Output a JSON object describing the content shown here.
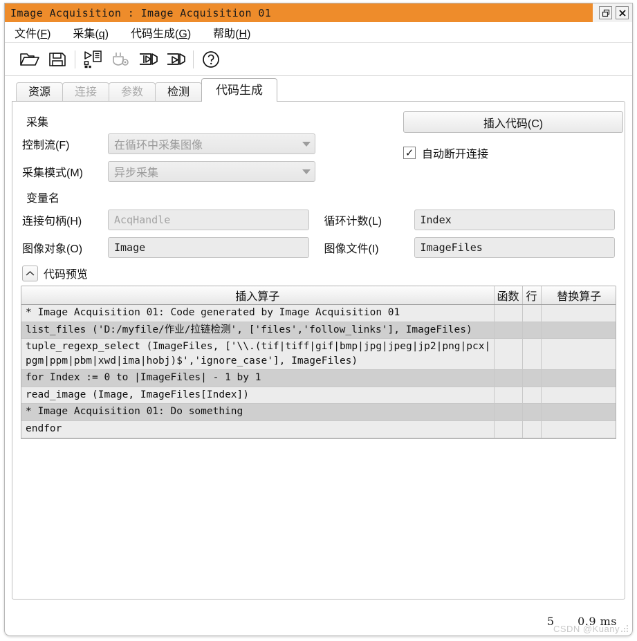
{
  "window": {
    "title": "Image Acquisition : Image Acquisition 01",
    "restore_icon": "restore-window-icon",
    "close_icon": "close-window-icon"
  },
  "menubar": {
    "items": [
      {
        "label": "文件",
        "accel": "F"
      },
      {
        "label": "采集",
        "accel": "q"
      },
      {
        "label": "代码生成",
        "accel": "G"
      },
      {
        "label": "帮助",
        "accel": "H"
      }
    ]
  },
  "toolbar": {
    "items": [
      {
        "icon": "open-folder-icon",
        "enabled": true
      },
      {
        "icon": "save-icon",
        "enabled": true
      },
      {
        "icon": "generate-code-icon",
        "enabled": true
      },
      {
        "icon": "connect-settings-icon",
        "enabled": false
      },
      {
        "icon": "live-grab-start-icon",
        "enabled": true
      },
      {
        "icon": "snap-grab-icon",
        "enabled": true
      },
      {
        "icon": "help-icon",
        "enabled": true
      }
    ]
  },
  "tabs": [
    {
      "label": "资源",
      "state": "normal"
    },
    {
      "label": "连接",
      "state": "disabled"
    },
    {
      "label": "参数",
      "state": "disabled"
    },
    {
      "label": "检测",
      "state": "normal"
    },
    {
      "label": "代码生成",
      "state": "selected"
    }
  ],
  "form": {
    "acquire_group_title": "采集",
    "control_flow_label": "控制流(F)",
    "control_flow_value": "在循环中采集图像",
    "acquire_mode_label": "采集模式(M)",
    "acquire_mode_value": "异步采集",
    "variables_group_title": "变量名",
    "handle_label": "连接句柄(H)",
    "handle_value": "AcqHandle",
    "image_object_label": "图像对象(O)",
    "image_object_value": "Image",
    "loop_counter_label": "循环计数(L)",
    "loop_counter_value": "Index",
    "image_files_label": "图像文件(I)",
    "image_files_value": "ImageFiles",
    "insert_code_button": "插入代码(C)",
    "auto_disconnect_label": "自动断开连接",
    "auto_disconnect_checked": true,
    "checkmark": "✓"
  },
  "preview": {
    "title": "代码预览",
    "collapse_icon": "chevron-up-icon",
    "columns": [
      "插入算子",
      "函数",
      "行",
      "替换算子"
    ],
    "rows": [
      {
        "code": "* Image Acquisition 01: Code generated by Image Acquisition 01",
        "func": "",
        "line": "",
        "replace": ""
      },
      {
        "code": "list_files ('D:/myfile/作业/拉链检测', ['files','follow_links'], ImageFiles)",
        "func": "",
        "line": "",
        "replace": ""
      },
      {
        "code": "tuple_regexp_select (ImageFiles, ['\\\\.(tif|tiff|gif|bmp|jpg|jpeg|jp2|png|pcx|pgm|ppm|pbm|xwd|ima|hobj)$','ignore_case'], ImageFiles)",
        "func": "",
        "line": "",
        "replace": ""
      },
      {
        "code": "for Index := 0 to |ImageFiles| - 1 by 1",
        "func": "",
        "line": "",
        "replace": ""
      },
      {
        "code": "read_image (Image, ImageFiles[Index])",
        "func": "",
        "line": "",
        "replace": ""
      },
      {
        "code": "* Image Acquisition 01: Do something",
        "func": "",
        "line": "",
        "replace": ""
      },
      {
        "code": "endfor",
        "func": "",
        "line": "",
        "replace": ""
      }
    ]
  },
  "statusbar": {
    "count": "5",
    "time": "0.9 ms",
    "watermark": "CSDN @Kuany"
  },
  "colors": {
    "title_bar": "#ee8c2b",
    "row_odd": "#ececec",
    "row_even": "#cfcfcf"
  }
}
